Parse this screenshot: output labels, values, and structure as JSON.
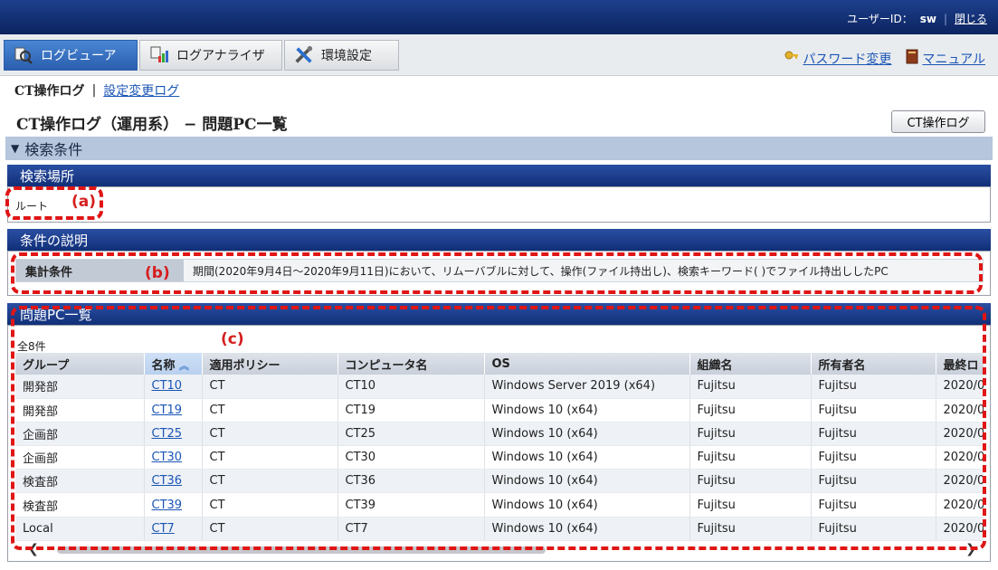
{
  "header": {
    "user_label": "ユーザーID：",
    "user_id": "sw",
    "close": "閉じる"
  },
  "tabs": [
    {
      "label": "ログビューア",
      "icon": "log-viewer-icon",
      "active": true
    },
    {
      "label": "ログアナライザ",
      "icon": "log-analyzer-icon",
      "active": false
    },
    {
      "label": "環境設定",
      "icon": "settings-tools-icon",
      "active": false
    }
  ],
  "links": {
    "password": "パスワード変更",
    "manual": "マニュアル"
  },
  "sublinks": {
    "current": "CT操作ログ",
    "separator": "|",
    "other": "設定変更ログ"
  },
  "page": {
    "title": "CT操作ログ（運用系） − 問題PC一覧",
    "ct_button": "CT操作ログ"
  },
  "condition_bar": {
    "arrow": "▼",
    "label": "検索条件"
  },
  "location": {
    "title": "検索場所",
    "value": "ルート",
    "marker": "(a)"
  },
  "description": {
    "title": "条件の説明",
    "label": "集計条件",
    "marker": "(b)",
    "value": "期間(2020年9月4日～2020年9月11日)において、リムーバブルに対して、操作(ファイル持出し)、検索キーワード( )でファイル持出ししたPC"
  },
  "pc_list": {
    "title": "問題PC一覧",
    "marker": "(c)",
    "count": "全8件",
    "columns": [
      "グループ",
      "名称",
      "適用ポリシー",
      "コンピュータ名",
      "OS",
      "組織名",
      "所有者名",
      "最終ロ"
    ],
    "rows": [
      [
        "開発部",
        "CT10",
        "CT",
        "CT10",
        "Windows Server 2019 (x64)",
        "Fujitsu",
        "Fujitsu",
        "2020/0"
      ],
      [
        "開発部",
        "CT19",
        "CT",
        "CT19",
        "Windows 10 (x64)",
        "Fujitsu",
        "Fujitsu",
        "2020/0"
      ],
      [
        "企画部",
        "CT25",
        "CT",
        "CT25",
        "Windows 10 (x64)",
        "Fujitsu",
        "Fujitsu",
        "2020/0"
      ],
      [
        "企画部",
        "CT30",
        "CT",
        "CT30",
        "Windows 10 (x64)",
        "Fujitsu",
        "Fujitsu",
        "2020/0"
      ],
      [
        "検査部",
        "CT36",
        "CT",
        "CT36",
        "Windows 10 (x64)",
        "Fujitsu",
        "Fujitsu",
        "2020/0"
      ],
      [
        "検査部",
        "CT39",
        "CT",
        "CT39",
        "Windows 10 (x64)",
        "Fujitsu",
        "Fujitsu",
        "2020/0"
      ],
      [
        "Local",
        "CT7",
        "CT",
        "CT7",
        "Windows 10 (x64)",
        "Fujitsu",
        "Fujitsu",
        "2020/0"
      ]
    ]
  },
  "colors": {
    "accent_red": "#e01515",
    "header_blue": "#112f78",
    "link_blue": "#1a55b5"
  }
}
